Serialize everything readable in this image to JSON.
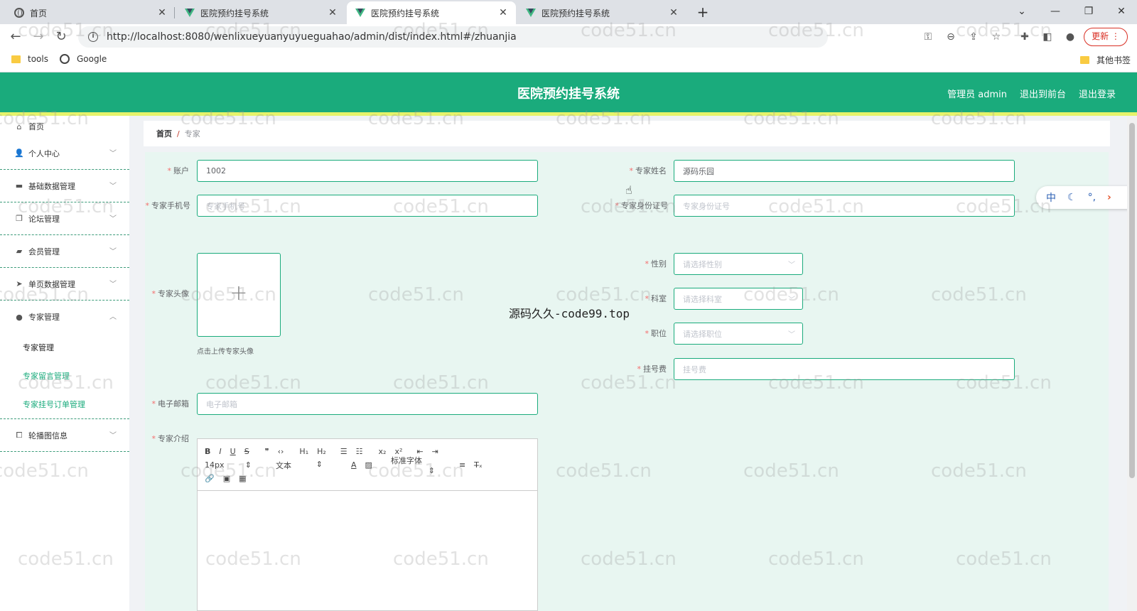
{
  "browser": {
    "tabs": [
      {
        "title": "首页",
        "icon": "globe-icon",
        "active": false
      },
      {
        "title": "医院预约挂号系统",
        "icon": "vue-logo-icon",
        "active": false
      },
      {
        "title": "医院预约挂号系统",
        "icon": "vue-logo-icon",
        "active": true
      },
      {
        "title": "医院预约挂号系统",
        "icon": "vue-logo-icon",
        "active": false
      }
    ],
    "url": "http://localhost:8080/wenlixueyuanyuyueguahao/admin/dist/index.html#/zhuanjia",
    "update_label": "更新",
    "bookmarks": [
      {
        "label": "tools",
        "icon": "folder-icon"
      },
      {
        "label": "Google",
        "icon": "globe-icon"
      }
    ],
    "other_bookmarks": "其他书签"
  },
  "header": {
    "title": "医院预约挂号系统",
    "links": [
      "管理员 admin",
      "退出到前台",
      "退出登录"
    ],
    "color": "#1aab7c"
  },
  "sidebar": {
    "items": [
      {
        "label": "首页",
        "icon": "home-icon"
      },
      {
        "label": "个人中心",
        "icon": "user-icon"
      },
      {
        "label": "基础数据管理",
        "icon": "monitor-icon"
      },
      {
        "label": "论坛管理",
        "icon": "copy-icon"
      },
      {
        "label": "会员管理",
        "icon": "briefcase-icon"
      },
      {
        "label": "单页数据管理",
        "icon": "send-icon"
      },
      {
        "label": "专家管理",
        "icon": "pin-icon"
      },
      {
        "label": "轮播图信息",
        "icon": "crop-icon"
      }
    ],
    "sub_items": [
      "专家管理",
      "专家留言管理",
      "专家挂号订单管理"
    ]
  },
  "breadcrumb": {
    "home": "首页",
    "sep": "/",
    "current": "专家"
  },
  "form": {
    "account": {
      "label": "账户",
      "value": "1002"
    },
    "name": {
      "label": "专家姓名",
      "value": "源码乐园"
    },
    "phone": {
      "label": "专家手机号",
      "placeholder": "专家手机号"
    },
    "idcard": {
      "label": "专家身份证号",
      "placeholder": "专家身份证号"
    },
    "avatar": {
      "label": "专家头像",
      "hint": "点击上传专家头像"
    },
    "gender": {
      "label": "性别",
      "placeholder": "请选择性别"
    },
    "dept": {
      "label": "科室",
      "placeholder": "请选择科室"
    },
    "title": {
      "label": "职位",
      "placeholder": "请选择职位"
    },
    "fee": {
      "label": "挂号费",
      "placeholder": "挂号费"
    },
    "email": {
      "label": "电子邮箱",
      "placeholder": "电子邮箱"
    },
    "intro": {
      "label": "专家介绍"
    }
  },
  "editor": {
    "font_size": "14px",
    "block_type": "文本",
    "font_family": "标准字体"
  },
  "overlay_text": "源码久久-code99.top",
  "side_widget": {
    "lang": "中"
  },
  "watermark": "code51.cn"
}
